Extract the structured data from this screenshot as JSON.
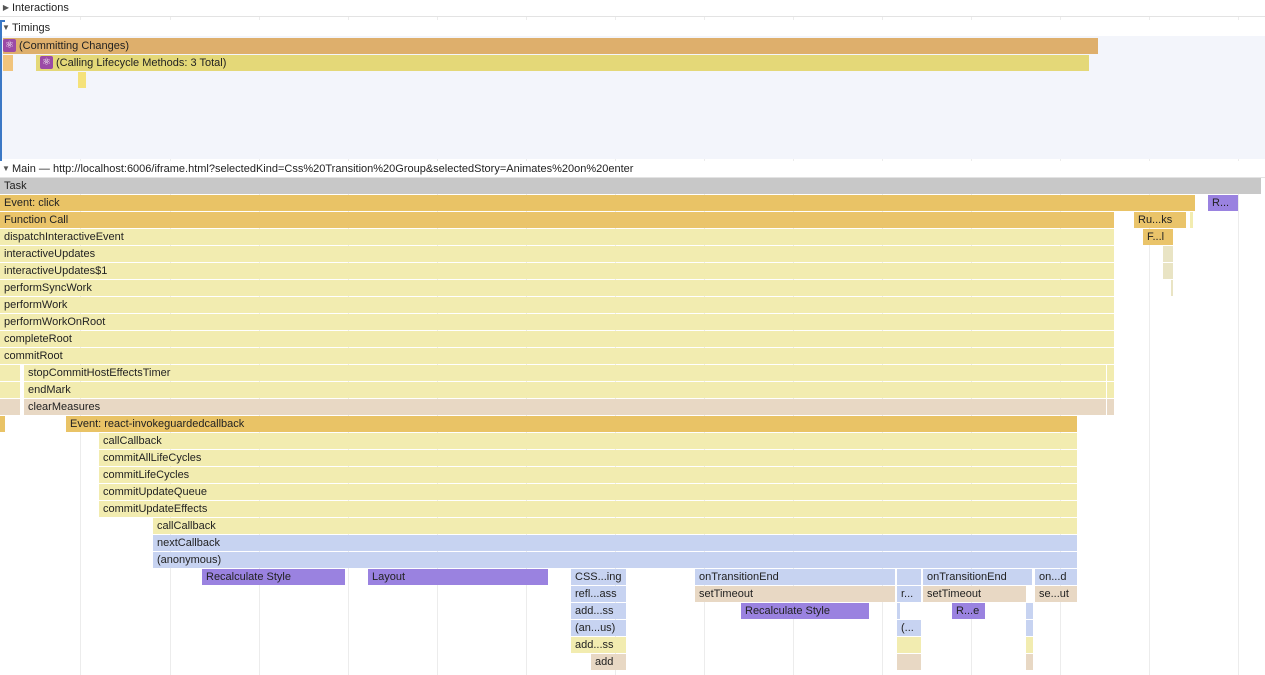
{
  "colors": {
    "task": "#c8c8c8",
    "event": "#e9c366",
    "function_call": "#eac46a",
    "script": "#f2ecb0",
    "gc": "#e8d8c4",
    "timer": "#e8d8c4",
    "style": "#9a82e0",
    "anonymous": "#c7d3f1",
    "committing": "#deaf6c",
    "lifecycle": "#e4d878",
    "yellow_mark": "#f5e27a"
  },
  "sections": {
    "interactions": "Interactions",
    "timings": "Timings",
    "main": "Main — http://localhost:6006/iframe.html?selectedKind=Css%20Transition%20Group&selectedStory=Animates%20on%20enter"
  },
  "timings": {
    "committing_label": "(Committing Changes)",
    "lifecycle_label": "(Calling Lifecycle Methods: 3 Total)",
    "icon": "react-logo-icon"
  },
  "flame": {
    "task": "Task",
    "event_click": "Event: click",
    "r_small": "R...",
    "function_call": "Function Call",
    "ru_ks": "Ru...ks",
    "dispatch": "dispatchInteractiveEvent",
    "f_l": "F...l",
    "interactive_updates": "interactiveUpdates",
    "interactive_updates1": "interactiveUpdates$1",
    "perform_sync_work": "performSyncWork",
    "perform_work": "performWork",
    "perform_work_on_root": "performWorkOnRoot",
    "complete_root": "completeRoot",
    "commit_root": "commitRoot",
    "stop_commit": "stopCommitHostEffectsTimer",
    "end_mark": "endMark",
    "clear_measures": "clearMeasures",
    "react_invoke": "Event: react-invokeguardedcallback",
    "call_callback": "callCallback",
    "commit_all": "commitAllLifeCycles",
    "commit_life": "commitLifeCycles",
    "commit_update_queue": "commitUpdateQueue",
    "commit_update_effects": "commitUpdateEffects",
    "call_callback2": "callCallback",
    "next_callback": "nextCallback",
    "anonymous": "(anonymous)",
    "recalc_style": "Recalculate Style",
    "layout": "Layout",
    "css_ing": "CSS...ing",
    "on_transition_end1": "onTransitionEnd",
    "r_dots": "r...",
    "on_transition_end2": "onTransitionEnd",
    "on_d": "on...d",
    "refl_ass": "refl...ass",
    "set_timeout1": "setTimeout",
    "set_timeout2": "setTimeout",
    "se_ut": "se...ut",
    "add_ss1": "add...ss",
    "recalc_style2": "Recalculate Style",
    "r_e": "R...e",
    "an_us": "(an...us)",
    "paren_dots": "(...",
    "add_ss2": "add...ss",
    "add": "add"
  }
}
